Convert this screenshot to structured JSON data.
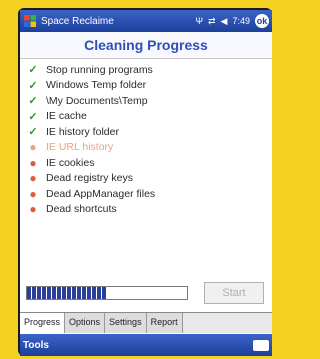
{
  "titlebar": {
    "title": "Space Reclaime",
    "icons": [
      "signal-icon",
      "connectivity-icon",
      "volume-icon"
    ],
    "time": "7:49",
    "ok_label": "ok"
  },
  "header": {
    "title": "Cleaning Progress"
  },
  "tasks": [
    {
      "label": "Stop running programs",
      "status": "done"
    },
    {
      "label": "Windows Temp folder",
      "status": "done"
    },
    {
      "label": "\\My Documents\\Temp",
      "status": "done"
    },
    {
      "label": "IE cache",
      "status": "done"
    },
    {
      "label": "IE history folder",
      "status": "done"
    },
    {
      "label": "IE URL history",
      "status": "current"
    },
    {
      "label": "IE cookies",
      "status": "pending"
    },
    {
      "label": "Dead registry keys",
      "status": "pending"
    },
    {
      "label": "Dead AppManager files",
      "status": "pending"
    },
    {
      "label": "Dead shortcuts",
      "status": "pending"
    }
  ],
  "progress": {
    "value": 0.5
  },
  "start_button": {
    "label": "Start"
  },
  "tabs": [
    "Progress",
    "Options",
    "Settings",
    "Report"
  ],
  "menubar": {
    "left": "Tools"
  },
  "colors": {
    "accent": "#1d3f9a",
    "done": "#2e9a2e",
    "pending": "#e05a3a",
    "frame": "#f4d020"
  }
}
